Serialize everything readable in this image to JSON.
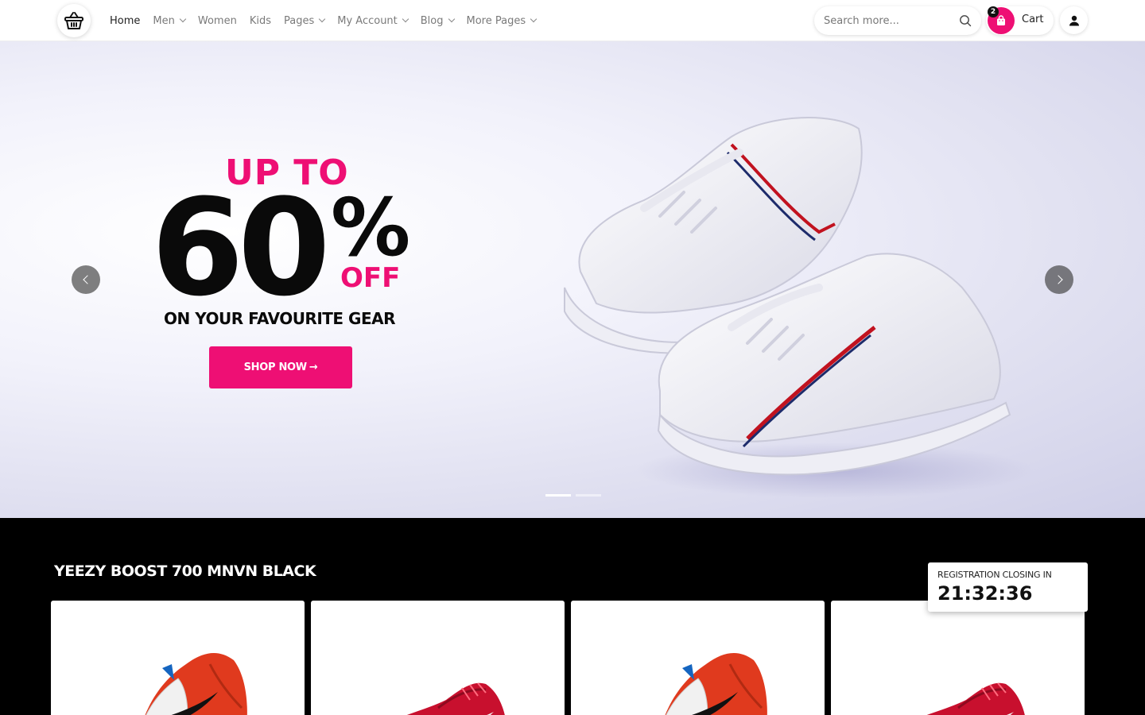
{
  "header": {
    "nav": [
      {
        "label": "Home",
        "dropdown": false
      },
      {
        "label": "Men",
        "dropdown": true
      },
      {
        "label": "Women",
        "dropdown": false
      },
      {
        "label": "Kids",
        "dropdown": false
      },
      {
        "label": "Pages",
        "dropdown": true
      },
      {
        "label": "My Account",
        "dropdown": true
      },
      {
        "label": "Blog",
        "dropdown": true
      },
      {
        "label": "More Pages",
        "dropdown": true
      }
    ],
    "search_placeholder": "Search more...",
    "cart_label": "Cart",
    "cart_count": "2"
  },
  "hero": {
    "up_to": "UP TO",
    "percent_value": "60",
    "percent_sign": "%",
    "off": "OFF",
    "tagline": "ON YOUR FAVOURITE GEAR",
    "cta": "SHOP NOW",
    "cta_arrow": "→",
    "slides": 2,
    "active_slide": 1
  },
  "products_section": {
    "title": "YEEZY BOOST 700 MNVN BLACK",
    "timer_label": "REGISTRATION CLOSING IN",
    "timer_value": "21:32:36",
    "cards": [
      {
        "image": "white-red-running-shoe"
      },
      {
        "image": "red-running-shoe"
      },
      {
        "image": "white-red-running-shoe"
      },
      {
        "image": "red-running-shoe"
      }
    ]
  },
  "colors": {
    "accent": "#ee0f74",
    "text_dark": "#0a0a0a",
    "section_bg": "#000000"
  }
}
